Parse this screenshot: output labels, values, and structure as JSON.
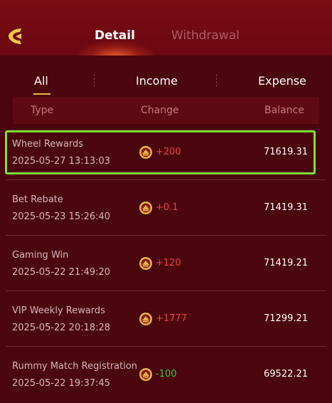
{
  "header": {
    "tabs": [
      {
        "label": "Detail",
        "active": true
      },
      {
        "label": "Withdrawal",
        "active": false
      }
    ]
  },
  "filters": [
    {
      "label": "All",
      "active": true
    },
    {
      "label": "Income",
      "active": false
    },
    {
      "label": "Expense",
      "active": false
    }
  ],
  "columns": {
    "type": "Type",
    "change": "Change",
    "balance": "Balance"
  },
  "records": [
    {
      "type": "Wheel Rewards",
      "time": "2025-05-27 13:13:03",
      "change": "+200",
      "balance": "71619.31",
      "highlighted": true
    },
    {
      "type": "Bet Rebate",
      "time": "2025-05-23 15:26:40",
      "change": "+0.1",
      "balance": "71419.31"
    },
    {
      "type": "Gaming Win",
      "time": "2025-05-22 21:49:20",
      "change": "+120",
      "balance": "71419.21"
    },
    {
      "type": "VIP Weekly Rewards",
      "time": "2025-05-22 20:18:28",
      "change": "+1777",
      "balance": "71299.21"
    },
    {
      "type": "Rummy Match Registration",
      "time": "2025-05-22 19:37:45",
      "change": "-100",
      "balance": "69522.21"
    }
  ],
  "colors": {
    "accent": "#e8b840",
    "positive": "#f0424c",
    "negative": "#3dc44e",
    "highlight": "#7ee03a"
  },
  "icons": {
    "back": "back-arrow-icon",
    "coin": "coin-icon"
  }
}
